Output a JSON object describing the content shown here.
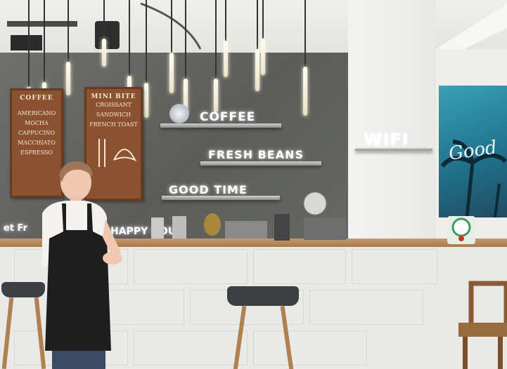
{
  "menu_board": {
    "title": "COFFEE",
    "items": [
      "AMERICANO",
      "MOCHA",
      "CAPPUCINO",
      "MACCHIATO",
      "ESPRESSO"
    ]
  },
  "mini_board": {
    "title": "MINI BITE",
    "items": [
      "CROISSANT",
      "SANDWICH",
      "FRENCH TOAST"
    ]
  },
  "neon": {
    "coffee": "COFFEE",
    "fresh_beans": "FRESH BEANS",
    "good_time": "GOOD TIME",
    "wifi": "WIFI",
    "happy_hour": "HAPPY HOUR"
  },
  "banner": {
    "script": "Good"
  },
  "colors": {
    "wall": "#646562",
    "board": "#8b5232",
    "counter_top": "#b38a5c",
    "banner": "#2b8aa3"
  }
}
